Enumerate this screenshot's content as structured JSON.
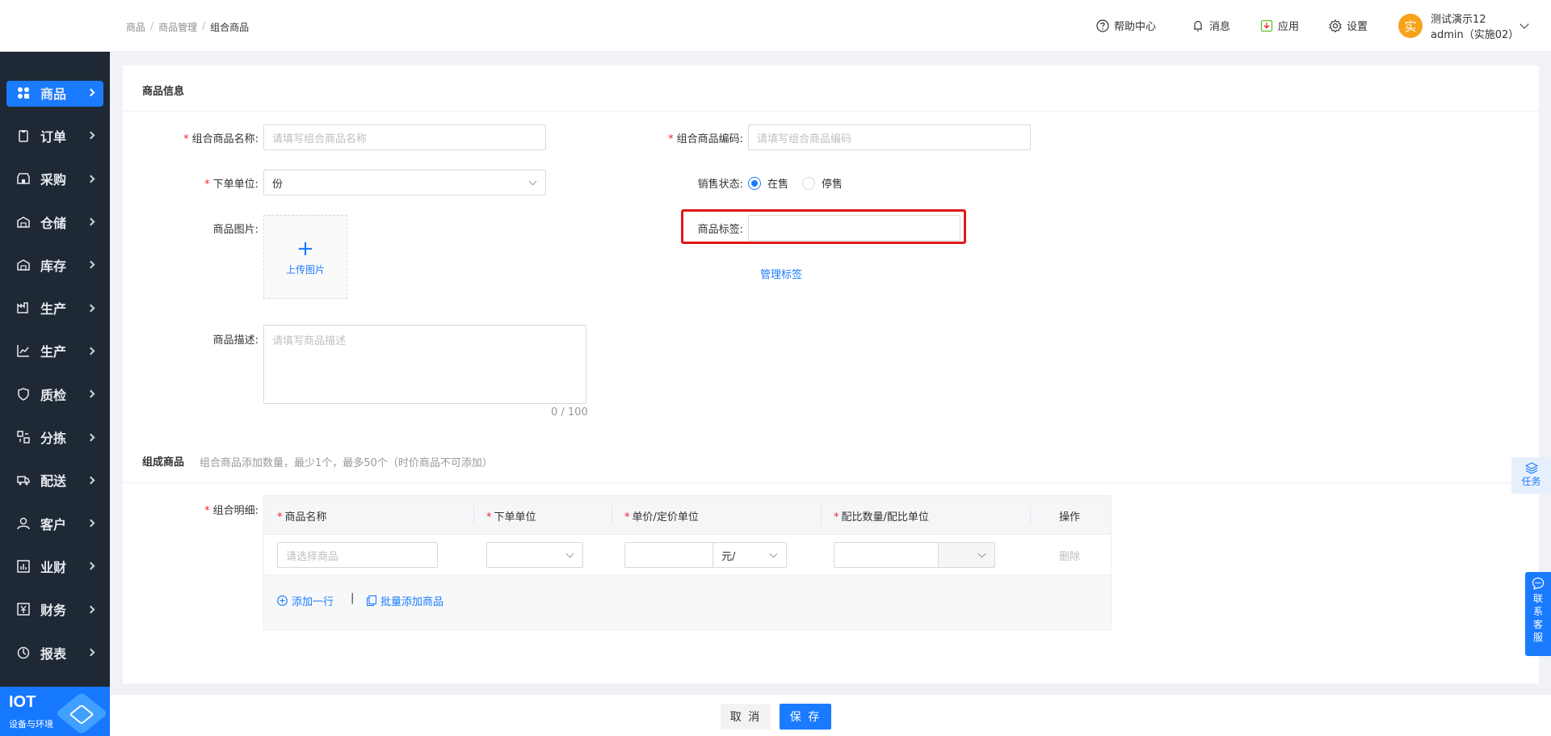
{
  "sidebar": {
    "items": [
      {
        "label": "商品",
        "icon": "grid-icon"
      },
      {
        "label": "订单",
        "icon": "clipboard-icon"
      },
      {
        "label": "采购",
        "icon": "store-icon"
      },
      {
        "label": "仓储",
        "icon": "warehouse-icon"
      },
      {
        "label": "库存",
        "icon": "warehouse-icon"
      },
      {
        "label": "生产",
        "icon": "factory-icon"
      },
      {
        "label": "生产",
        "icon": "chart-icon"
      },
      {
        "label": "质检",
        "icon": "shield-icon"
      },
      {
        "label": "分拣",
        "icon": "sort-icon"
      },
      {
        "label": "配送",
        "icon": "truck-icon"
      },
      {
        "label": "客户",
        "icon": "user-icon"
      },
      {
        "label": "业财",
        "icon": "bar-chart-icon"
      },
      {
        "label": "财务",
        "icon": "finance-icon"
      },
      {
        "label": "报表",
        "icon": "pie-icon"
      }
    ],
    "active_index": 0,
    "iot": {
      "title": "IOT",
      "subtitle": "设备与环境"
    }
  },
  "breadcrumb": [
    "商品",
    "商品管理",
    "组合商品"
  ],
  "topbar": {
    "help": "帮助中心",
    "messages": "消息",
    "apps": "应用",
    "settings": "设置",
    "avatar": "实",
    "user_name": "测试演示12",
    "user_org": "admin（实施02）"
  },
  "product_info": {
    "title": "商品信息",
    "name_label": "组合商品名称:",
    "name_placeholder": "请填写组合商品名称",
    "code_label": "组合商品编码:",
    "code_placeholder": "请填写组合商品编码",
    "unit_label": "下单单位:",
    "unit_value": "份",
    "status_label": "销售状态:",
    "status_on": "在售",
    "status_off": "停售",
    "status_selected": "在售",
    "image_label": "商品图片:",
    "upload_label": "上传图片",
    "tag_label": "商品标签:",
    "tag_value": "",
    "manage_tags": "管理标签",
    "desc_label": "商品描述:",
    "desc_placeholder": "请填写商品描述",
    "desc_count": "0 / 100"
  },
  "composition": {
    "title": "组成商品",
    "hint": "组合商品添加数量，最少1个，最多50个（时价商品不可添加）",
    "detail_label": "组合明细:",
    "columns": [
      "商品名称",
      "下单单位",
      "单价/定价单位",
      "配比数量/配比单位",
      "操作"
    ],
    "row": {
      "product_placeholder": "请选择商品",
      "unit_value": "",
      "price_value": "",
      "price_unit": "元/",
      "ratio_value": "",
      "ratio_unit": "",
      "delete": "删除"
    },
    "add_row": "添加一行",
    "batch_add": "批量添加商品"
  },
  "footer": {
    "cancel": "取 消",
    "save": "保 存"
  },
  "floating": {
    "task": "任务",
    "contact": [
      "联",
      "系",
      "客",
      "服"
    ]
  },
  "colors": {
    "primary": "#1a7bff",
    "sidebar_bg": "#1f2936",
    "required": "#f5222d",
    "highlight": "#e0181a",
    "avatar": "#f7a21b"
  }
}
